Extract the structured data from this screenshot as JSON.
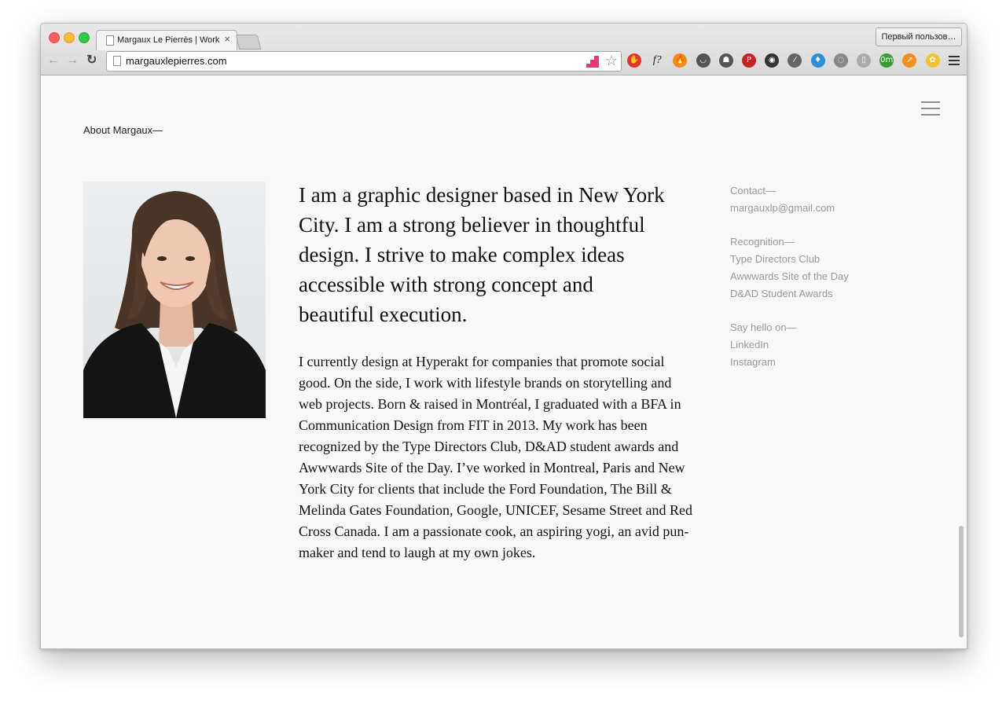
{
  "browser": {
    "tab_title": "Margaux Le Pierrès | Work",
    "tab_close": "×",
    "profile_button": "Первый пользов…",
    "url": "margauxlepierres.com",
    "nav_back": "←",
    "nav_forward": "→",
    "nav_reload": "↻",
    "star": "☆",
    "extensions": [
      {
        "name": "adblock-icon",
        "color": "#e0362c",
        "glyph": "✋"
      },
      {
        "name": "fontface-icon",
        "color": "#ffffff",
        "glyph": "f?"
      },
      {
        "name": "flame-icon",
        "color": "#f08a1c",
        "glyph": "🔥"
      },
      {
        "name": "pocket-icon",
        "color": "#555555",
        "glyph": "◡"
      },
      {
        "name": "evernote-icon",
        "color": "#555555",
        "glyph": "☗"
      },
      {
        "name": "pinterest-icon",
        "color": "#cb2027",
        "glyph": "P"
      },
      {
        "name": "camera-icon",
        "color": "#333333",
        "glyph": "◉"
      },
      {
        "name": "eyedropper-icon",
        "color": "#666666",
        "glyph": "⁄"
      },
      {
        "name": "diamond-icon",
        "color": "#2d8fd6",
        "glyph": "♦"
      },
      {
        "name": "refresh-ext-icon",
        "color": "#888888",
        "glyph": "◌"
      },
      {
        "name": "reader-icon",
        "color": "#aaaaaa",
        "glyph": "▯"
      },
      {
        "name": "timer-icon",
        "color": "#3a9a3a",
        "glyph": "0m"
      },
      {
        "name": "chart-ext-icon",
        "color": "#f09020",
        "glyph": "↗"
      },
      {
        "name": "puzzle-ext-icon",
        "color": "#f2c230",
        "glyph": "✿"
      }
    ]
  },
  "page": {
    "about_label": "About Margaux—",
    "intro": "I am a graphic designer based in New York City. I am a strong believer in thoughtful design. I strive to make complex ideas accessible with strong concept and beautiful execution.",
    "bio": "I currently design at Hyperakt for companies that promote social good. On the side, I work with lifestyle brands on storytelling and web projects. Born & raised in Montréal, I graduated with a BFA in Communication Design from FIT in 2013. My work has been recognized by the Type Directors Club, D&AD student awards and Awwwards Site of the Day. I’ve worked in Montreal, Paris and New York City for clients that include the Ford Foundation, The Bill & Melinda Gates Foundation, Google, UNICEF, Sesame Street and Red Cross Canada. I am a passionate cook, an aspiring yogi, an avid pun-maker and tend to laugh at my own jokes.",
    "contact": {
      "heading": "Contact—",
      "email": "margauxlp@gmail.com"
    },
    "recognition": {
      "heading": "Recognition—",
      "items": [
        "Type Directors Club",
        "Awwwards Site of the Day",
        "D&AD Student Awards"
      ]
    },
    "social": {
      "heading": "Say hello on—",
      "items": [
        "LinkedIn",
        "Instagram"
      ]
    }
  },
  "colors": {
    "page_background": "#f8f8f8",
    "text_primary": "#111111",
    "text_muted": "#9a9a9a"
  }
}
